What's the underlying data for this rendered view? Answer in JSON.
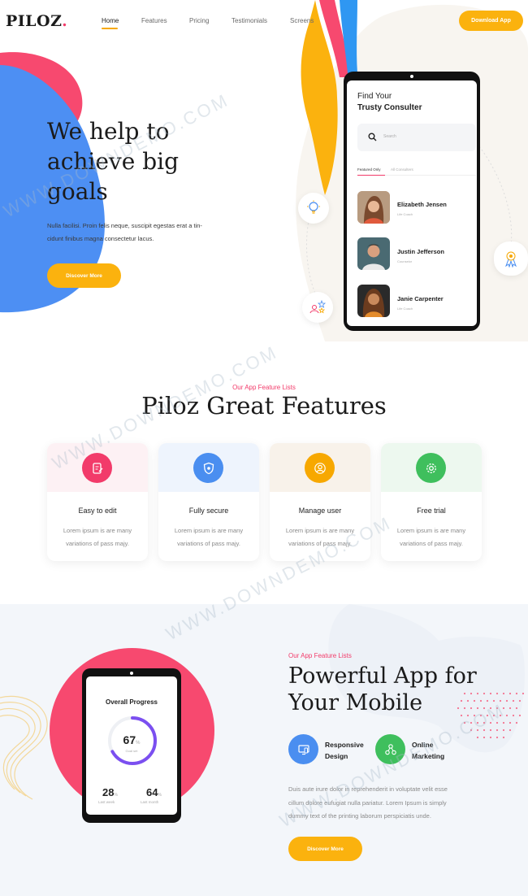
{
  "header": {
    "logo": "PILOZ",
    "logo_dot": ".",
    "nav": [
      "Home",
      "Features",
      "Pricing",
      "Testimonials",
      "Screens"
    ],
    "download_label": "Download App"
  },
  "hero": {
    "title_lines": [
      "We help to",
      "achieve big",
      "goals"
    ],
    "text_lines": [
      "Nulla facilisi. Proin felis neque, suscipit egestas erat a tin-",
      "cidunt finibus magna consectetur lacus."
    ],
    "button_label": "Discover More"
  },
  "phone_app": {
    "title_line1": "Find Your",
    "title_line2": "Trusty Consulter",
    "search_placeholder": "Search",
    "tabs": [
      "Featured Only",
      "All Consulters"
    ],
    "people": [
      {
        "name": "Elizabeth Jensen",
        "sub": "Life Coach"
      },
      {
        "name": "Justin Jefferson",
        "sub": "Counselor"
      },
      {
        "name": "Janie Carpenter",
        "sub": "Life Coach"
      }
    ]
  },
  "features": {
    "eyebrow": "Our App Feature Lists",
    "title": "Piloz Great Features",
    "cards": [
      {
        "title": "Easy to edit",
        "desc": "Lorem ipsum is are many variations of pass majy.",
        "icon": "edit-icon",
        "color": "#f23b6a",
        "bg": "#fdf1f4"
      },
      {
        "title": "Fully secure",
        "desc": "Lorem ipsum is are many variations of pass majy.",
        "icon": "shield-icon",
        "color": "#4a8ef0",
        "bg": "#eef4fd"
      },
      {
        "title": "Manage user",
        "desc": "Lorem ipsum is are many variations of pass majy.",
        "icon": "user-icon",
        "color": "#f7a800",
        "bg": "#f8f2ea"
      },
      {
        "title": "Free trial",
        "desc": "Lorem ipsum is are many variations of pass majy.",
        "icon": "settings-icon",
        "color": "#3fbf5d",
        "bg": "#edf8ef"
      }
    ]
  },
  "powerful": {
    "eyebrow": "Our App Feature Lists",
    "title_lines": [
      "Powerful App for",
      "Your Mobile"
    ],
    "items": [
      {
        "label_lines": [
          "Responsive",
          "Design"
        ],
        "icon": "monitor-icon",
        "color": "#4a8ef0"
      },
      {
        "label_lines": [
          "Online",
          "Marketing"
        ],
        "icon": "network-icon",
        "color": "#3fbf5d"
      }
    ],
    "text_lines": [
      "Duis aute irure dolor in reprehenderit in voluptate velit esse",
      "cillum dolore eufugiat nulla pariatur. Lorem Ipsum is simply",
      "dummy text of the printing laborum perspiciatis unde."
    ],
    "button_label": "Discover More",
    "progress": {
      "title": "Overall Progress",
      "value": "67",
      "unit": "%",
      "fraction": 0.67,
      "sub": "Goal set",
      "stats": [
        {
          "value": "28",
          "unit": "%",
          "label": "Last week"
        },
        {
          "value": "64",
          "unit": "%",
          "label": "Last month"
        }
      ]
    }
  },
  "watermark": "WWW.DOWNDEMO.COM",
  "colors": {
    "accent": "#fbb20e",
    "pink": "#f23b6a",
    "blue": "#4a8ef0",
    "green": "#3fbf5d"
  }
}
